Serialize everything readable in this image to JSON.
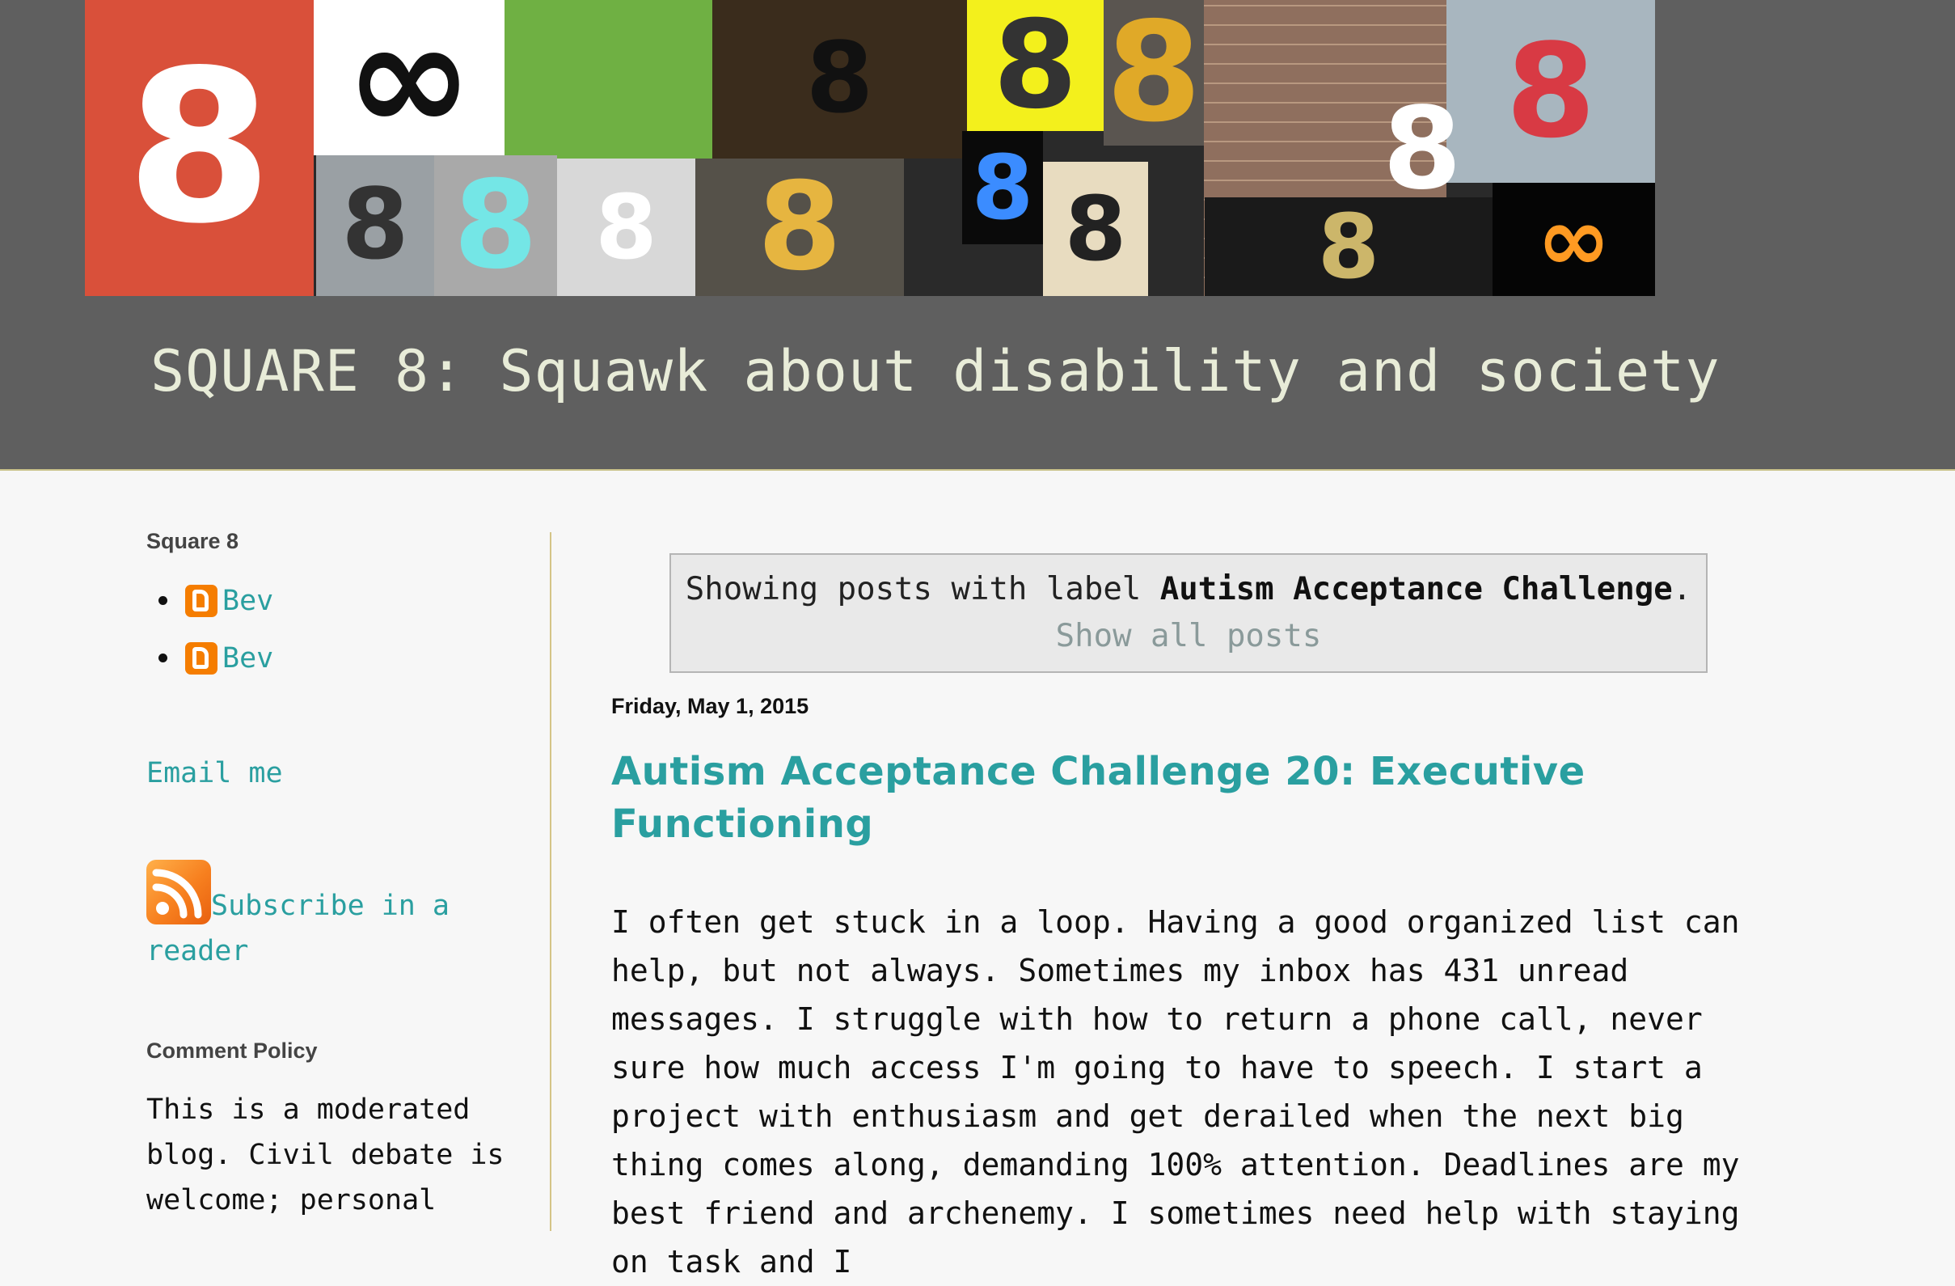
{
  "header": {
    "title": "SQUARE 8: Squawk about disability and society",
    "banner_alt": "collage of number eights"
  },
  "sidebar": {
    "heading": "Square 8",
    "authors": [
      {
        "name": "Bev"
      },
      {
        "name": "Bev"
      }
    ],
    "email_link": "Email me",
    "subscribe_link": "Subscribe in a reader",
    "comment_heading": "Comment Policy",
    "comment_text": "This is a moderated blog. Civil debate is welcome; personal"
  },
  "main": {
    "label_prefix": "Showing posts with label ",
    "label_name": "Autism Acceptance Challenge",
    "label_suffix": ".",
    "show_all": "Show all posts",
    "date": "Friday, May 1, 2015",
    "post_title": "Autism Acceptance Challenge 20: Executive Functioning",
    "post_body": "I often get stuck in a loop. Having a good organized list can help, but not always. Sometimes my inbox has 431 unread messages. I struggle with how to return a phone call, never sure how much access I'm going to have to speech. I start a project with enthusiasm and get derailed when the next big thing comes along, demanding 100% attention. Deadlines are my best friend and archenemy. I sometimes need help with staying on task and I"
  },
  "banner_tiles": [
    {
      "glyph": "8",
      "bg": "#d9503a",
      "fg": "#ffffff"
    },
    {
      "glyph": "∞",
      "bg": "#ffffff",
      "fg": "#111111"
    },
    {
      "glyph": "",
      "bg": "#6fb043",
      "fg": "#222222"
    },
    {
      "glyph": "8",
      "bg": "#3a2c1c",
      "fg": "#111111"
    },
    {
      "glyph": "8",
      "bg": "#f3f01c",
      "fg": "#333333"
    },
    {
      "glyph": "8",
      "bg": "#5a5550",
      "fg": "#e0a928"
    },
    {
      "glyph": "",
      "bg": "#9a7a68",
      "fg": "#ffffff"
    },
    {
      "glyph": "8",
      "bg": "#a8b6bf",
      "fg": "#d83a44"
    },
    {
      "glyph": "8",
      "bg": "#9aa0a4",
      "fg": "#333333"
    },
    {
      "glyph": "8",
      "bg": "#a9a9a9",
      "fg": "#74e6e6"
    },
    {
      "glyph": "8",
      "bg": "#d8d8d8",
      "fg": "#ffffff"
    },
    {
      "glyph": "8",
      "bg": "#555149",
      "fg": "#e6b540"
    },
    {
      "glyph": "8",
      "bg": "#0a0a0a",
      "fg": "#3b8cff"
    },
    {
      "glyph": "8",
      "bg": "#e8dcc0",
      "fg": "#222222"
    },
    {
      "glyph": "8",
      "bg": "#1a1a1a",
      "fg": "#ccb66a"
    },
    {
      "glyph": "8",
      "bg": "#b08a6a",
      "fg": "#ffffff"
    },
    {
      "glyph": "∞",
      "bg": "#050505",
      "fg": "#ff9a22"
    }
  ]
}
